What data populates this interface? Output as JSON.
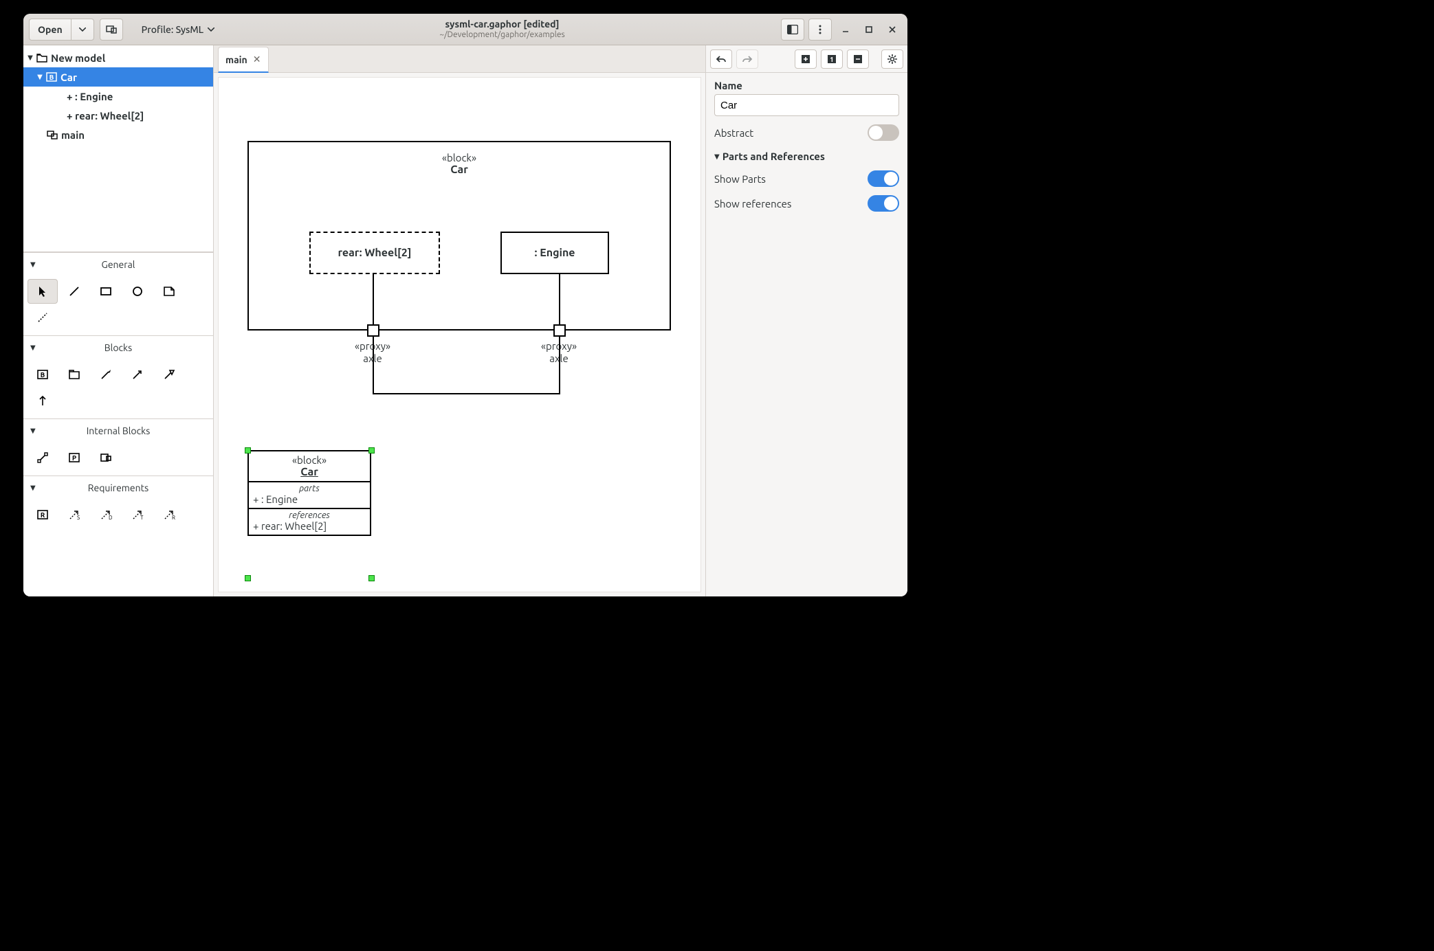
{
  "header": {
    "open_label": "Open",
    "profile_label": "Profile: SysML",
    "title": "sysml-car.gaphor [edited]",
    "subtitle": "~/Development/gaphor/examples"
  },
  "tree": {
    "root": "New model",
    "car": "Car",
    "engine": "+ : Engine",
    "rear": "+ rear: Wheel[2]",
    "main": "main"
  },
  "toolbox": {
    "groups": {
      "general": "General",
      "blocks": "Blocks",
      "internal": "Internal Blocks",
      "requirements": "Requirements"
    }
  },
  "tabs": {
    "current": "main"
  },
  "diagram": {
    "block_stereotype": "«block»",
    "block_name": "Car",
    "part_rear": "rear: Wheel[2]",
    "part_engine": ": Engine",
    "proxy_label": "«proxy»",
    "port_name": "axle",
    "small_block": {
      "stereotype": "«block»",
      "name": "Car",
      "parts_header": "parts",
      "parts_row": "+ : Engine",
      "refs_header": "references",
      "refs_row": "+ rear: Wheel[2]"
    }
  },
  "properties": {
    "name_label": "Name",
    "name_value": "Car",
    "abstract_label": "Abstract",
    "abstract": false,
    "section_label": "Parts and References",
    "show_parts_label": "Show Parts",
    "show_parts": true,
    "show_refs_label": "Show references",
    "show_refs": true
  }
}
